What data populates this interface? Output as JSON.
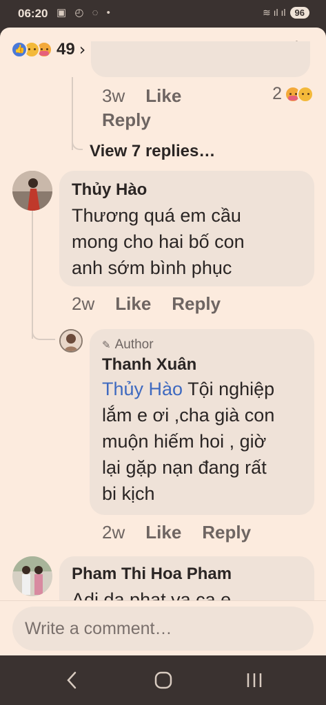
{
  "status_bar": {
    "time": "06:20",
    "left_icons": "▣ ◴ ◌ •",
    "signal": "≋ ıl ıl",
    "battery": "96"
  },
  "header": {
    "reaction_count": "49",
    "reaction_icons": [
      "like-reaction-icon",
      "sad-reaction-icon",
      "care-reaction-icon"
    ]
  },
  "previous_reply": {
    "time": "3w",
    "like_label": "Like",
    "reply_label": "Reply",
    "reaction_count": "2"
  },
  "view_replies": "View 7 replies…",
  "comments": [
    {
      "name": "Thủy Hào",
      "text_lines": [
        "Thương quá em cầu",
        "mong cho hai bố con",
        "anh sớm bình phục"
      ],
      "time": "2w",
      "like_label": "Like",
      "reply_label": "Reply"
    },
    {
      "badge": "Author",
      "name": "Thanh Xuân",
      "mention": "Thủy Hào",
      "text_first": " Tội nghiệp",
      "text_lines": [
        "lắm e ơi ,cha già con",
        "muộn hiếm hoi , giờ",
        "lại gặp nạn đang rất",
        "bi kịch"
      ],
      "time": "2w",
      "like_label": "Like",
      "reply_label": "Reply"
    },
    {
      "name": "Pham Thi Hoa Pham",
      "text_partial": "Adi da phat va ca e"
    }
  ],
  "composer": {
    "placeholder": "Write a comment…"
  },
  "colors": {
    "sheet_bg": "#fcebde",
    "bubble_bg": "#efe2d8",
    "mention": "#3f6ac0",
    "like_reaction": "#4a79d8"
  }
}
